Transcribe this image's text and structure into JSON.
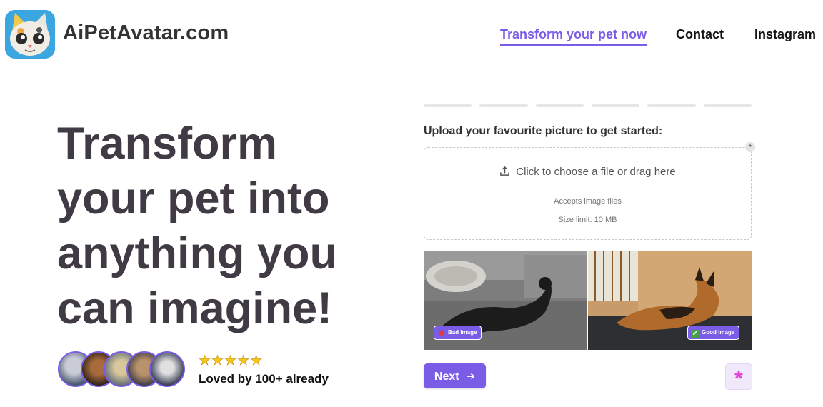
{
  "brand": {
    "name": "AiPetAvatar.com",
    "logo_icon": "cat-avatar-logo-icon"
  },
  "nav": [
    {
      "label": "Transform your pet now",
      "active": true
    },
    {
      "label": "Contact",
      "active": false
    },
    {
      "label": "Instagram",
      "active": false
    }
  ],
  "hero": {
    "lines": [
      "Transform",
      "your pet into",
      "anything you",
      "can imagine!"
    ]
  },
  "social_proof": {
    "stars": "★★★★★",
    "rating": 5,
    "text": "Loved by 100+ already"
  },
  "form": {
    "progress_steps": 6,
    "current_step": 0,
    "upload_label": "Upload your favourite picture to get started:",
    "required_marker": "*",
    "dropzone": {
      "main": "Click to choose a file or drag here",
      "accepts": "Accepts image files",
      "size_limit": "Size limit: 10 MB"
    },
    "examples": [
      {
        "badge": "Bad image",
        "badge_icon": "red-x-icon"
      },
      {
        "badge": "Good image",
        "badge_icon": "green-check-icon"
      }
    ],
    "next_label": "Next",
    "next_icon": "arrow-right-icon",
    "help_icon": "asterisk-icon"
  },
  "colors": {
    "accent": "#7a5ce6",
    "heading": "#403a44",
    "help_pink": "#e23fd9"
  }
}
